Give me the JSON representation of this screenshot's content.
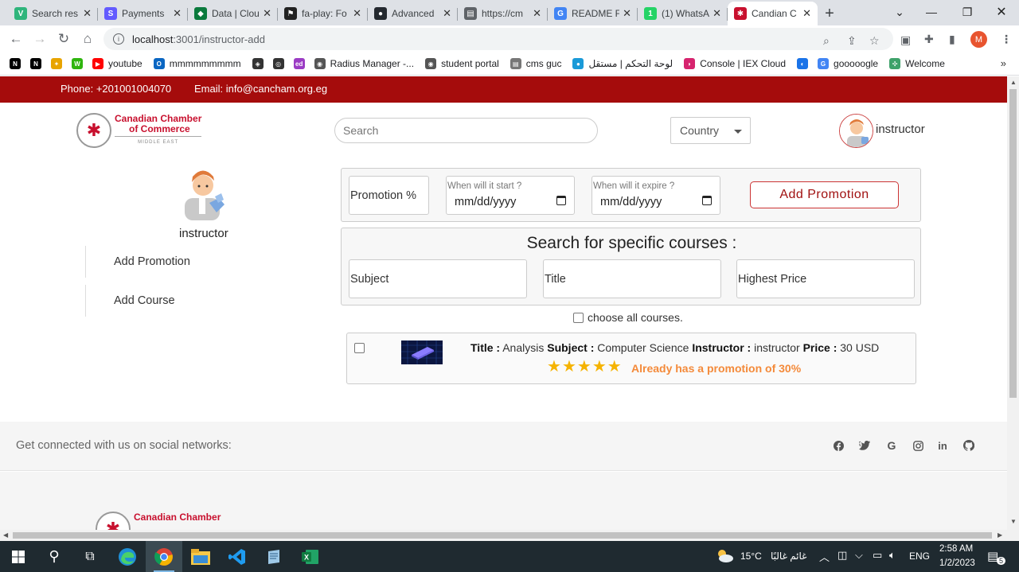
{
  "browser": {
    "tabs": [
      {
        "title": "Search res",
        "color": "#2fb57c",
        "glyph": "V"
      },
      {
        "title": "Payments",
        "color": "#635bff",
        "glyph": "S"
      },
      {
        "title": "Data | Clou",
        "color": "#0a7a3d",
        "glyph": "◆"
      },
      {
        "title": "fa-play: Fo",
        "color": "#222222",
        "glyph": "⚑"
      },
      {
        "title": "Advanced",
        "color": "#24292f",
        "glyph": "●"
      },
      {
        "title": "https://cm",
        "color": "#5f6368",
        "glyph": "▤"
      },
      {
        "title": "README F",
        "color": "#4285f4",
        "glyph": "G"
      },
      {
        "title": "(1) WhatsA",
        "color": "#25d366",
        "glyph": "1"
      },
      {
        "title": "Candian C",
        "color": "#c8102e",
        "glyph": "✱",
        "active": true
      }
    ],
    "url_host": "localhost",
    "url_rest": ":3001/instructor-add",
    "profile_initial": "M",
    "bookmarks": [
      {
        "label": "",
        "color": "#000000",
        "glyph": "N"
      },
      {
        "label": "",
        "color": "#000000",
        "glyph": "N"
      },
      {
        "label": "",
        "color": "#e8a400",
        "glyph": "✦"
      },
      {
        "label": "",
        "color": "#2fb50e",
        "glyph": "W"
      },
      {
        "label": "youtube",
        "color": "#ff0000",
        "glyph": "▶"
      },
      {
        "label": "mmmmmmmmm",
        "color": "#0a66c2",
        "glyph": "O"
      },
      {
        "label": "",
        "color": "#333333",
        "glyph": "◈"
      },
      {
        "label": "",
        "color": "#333333",
        "glyph": "◎"
      },
      {
        "label": "",
        "color": "#9b3cc4",
        "glyph": "ed"
      },
      {
        "label": "Radius Manager -...",
        "color": "#555555",
        "glyph": "◉"
      },
      {
        "label": "student portal",
        "color": "#555555",
        "glyph": "◉"
      },
      {
        "label": "cms guc",
        "color": "#777777",
        "glyph": "▤"
      },
      {
        "label": "لوحة التحكم | مستقل",
        "color": "#1a9ad8",
        "glyph": "●"
      },
      {
        "label": "Console | IEX Cloud",
        "color": "#d6246e",
        "glyph": "◗"
      },
      {
        "label": "",
        "color": "#1a73e8",
        "glyph": "◐"
      },
      {
        "label": "gooooogle",
        "color": "#4285f4",
        "glyph": "G"
      },
      {
        "label": "Welcome",
        "color": "#3fa26a",
        "glyph": "✣"
      }
    ]
  },
  "site": {
    "phone": "Phone: +201001004070",
    "email": "Email: info@cancham.org.eg",
    "logo_line1": "Canadian Chamber",
    "logo_line2": "of Commerce",
    "logo_sub": "MIDDLE EAST",
    "search_placeholder": "Search",
    "country_label": "Country",
    "user_name": "instructor"
  },
  "sidebar": {
    "name": "instructor",
    "links": [
      "Add Promotion",
      "Add Course"
    ]
  },
  "promotion": {
    "percent_placeholder": "Promotion %",
    "start_label": "When will it start ?",
    "start_value": "mm/dd/yyyy",
    "expire_label": "When will it expire ?",
    "expire_value": "mm/dd/yyyy",
    "button": "Add Promotion"
  },
  "course_search": {
    "title": "Search for specific courses :",
    "subject_placeholder": "Subject",
    "title_placeholder": "Title",
    "price_placeholder": "Highest Price",
    "choose_all": "choose all courses."
  },
  "course": {
    "title_label": "Title :",
    "title": "Analysis",
    "subject_label": "Subject :",
    "subject": "Computer Science",
    "instructor_label": "Instructor :",
    "instructor": "instructor",
    "price_label": "Price :",
    "price": "30 USD",
    "rating": 5,
    "promo_note": "Already has a promotion of 30%"
  },
  "footer": {
    "social_text": "Get connected with us on social networks:",
    "social_icons": [
      "facebook-icon",
      "twitter-icon",
      "google-icon",
      "instagram-icon",
      "linkedin-icon",
      "github-icon"
    ]
  },
  "taskbar": {
    "weather": "15°C",
    "weather_text": "غائم غالبًا",
    "lang": "ENG",
    "time": "2:58 AM",
    "date": "1/2/2023",
    "notif_count": "5"
  }
}
